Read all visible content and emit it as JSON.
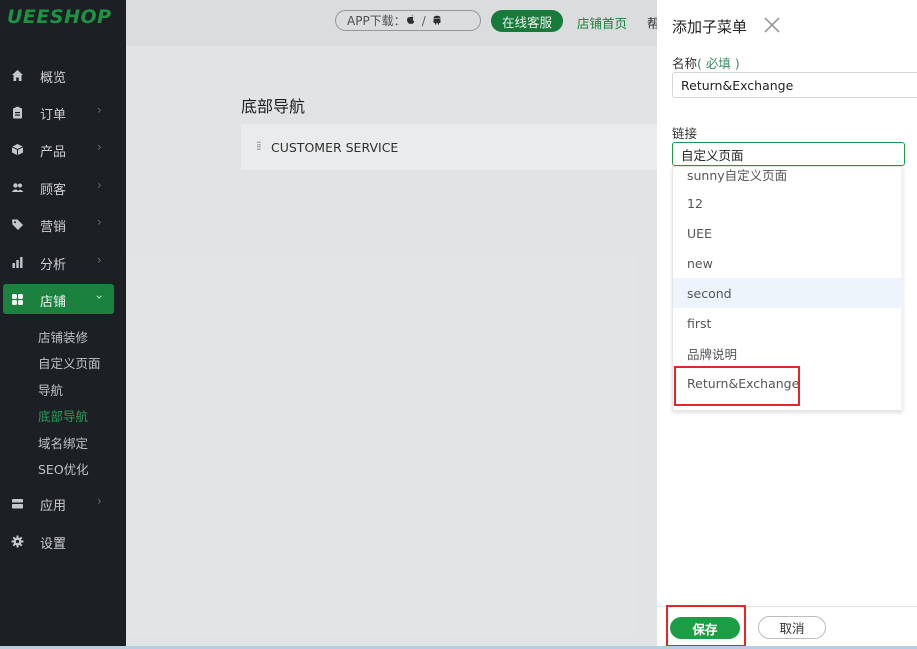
{
  "brand": {
    "logo": "UEESHOP"
  },
  "sidebar": {
    "items": [
      {
        "label": "概览",
        "icon": "home-icon"
      },
      {
        "label": "订单",
        "icon": "clipboard-icon"
      },
      {
        "label": "产品",
        "icon": "box-icon"
      },
      {
        "label": "顾客",
        "icon": "users-icon"
      },
      {
        "label": "营销",
        "icon": "tag-icon"
      },
      {
        "label": "分析",
        "icon": "bar-chart-icon"
      },
      {
        "label": "店铺",
        "icon": "grid-icon"
      },
      {
        "label": "应用",
        "icon": "layers-icon"
      },
      {
        "label": "设置",
        "icon": "gear-icon"
      }
    ],
    "store_sub": [
      {
        "label": "店铺装修"
      },
      {
        "label": "自定义页面"
      },
      {
        "label": "导航"
      },
      {
        "label": "底部导航"
      },
      {
        "label": "域名绑定"
      },
      {
        "label": "SEO优化"
      }
    ],
    "accent": "#1c8a42"
  },
  "topbar": {
    "app_download": "APP下载：",
    "app_sep": "/",
    "online_service": "在线客服",
    "store_home": "店铺首页",
    "help": "帮"
  },
  "main": {
    "title": "底部导航",
    "rows": [
      {
        "label": "CUSTOMER SERVICE"
      }
    ]
  },
  "panel": {
    "title": "添加子菜单",
    "name_label": "名称",
    "name_required": "( 必填 )",
    "name_value": "Return&Exchange",
    "link_label": "链接",
    "link_value": "自定义页面",
    "options": [
      {
        "label": "sunny自定义页面"
      },
      {
        "label": "12"
      },
      {
        "label": "UEE"
      },
      {
        "label": "new"
      },
      {
        "label": "second"
      },
      {
        "label": "first"
      },
      {
        "label": "品牌说明"
      },
      {
        "label": "Return&Exchange"
      }
    ],
    "save": "保存",
    "cancel": "取消"
  }
}
